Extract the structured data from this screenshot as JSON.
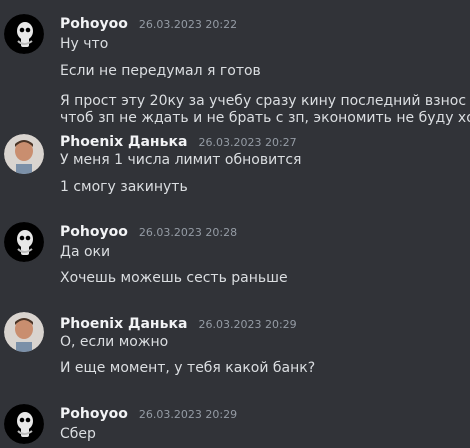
{
  "messages": [
    {
      "author": "Pohoyoo",
      "timestamp": "26.03.2023 20:22",
      "avatar": "skull-icon",
      "lines": [
        "Ну что",
        "Если не передумал я готов",
        "Я прост эту 20ку за учебу сразу кину последний взнос",
        "чтоб зп не ждать и не брать с зп, экономить не буду хоть"
      ]
    },
    {
      "author": "Phoenix Данька",
      "timestamp": "26.03.2023 20:27",
      "avatar": "person-icon",
      "lines": [
        "У меня 1 числа лимит обновится",
        "1 смогу закинуть"
      ]
    },
    {
      "author": "Pohoyoo",
      "timestamp": "26.03.2023 20:28",
      "avatar": "skull-icon",
      "lines": [
        "Да оки",
        "Хочешь можешь сесть раньше"
      ]
    },
    {
      "author": "Phoenix Данька",
      "timestamp": "26.03.2023 20:29",
      "avatar": "person-icon",
      "lines": [
        "О, если можно",
        "И еще момент, у тебя какой банк?"
      ]
    },
    {
      "author": "Pohoyoo",
      "timestamp": "26.03.2023 20:29",
      "avatar": "skull-icon",
      "lines": [
        "Сбер"
      ]
    }
  ],
  "emoji": "laughing-crying-emoji"
}
